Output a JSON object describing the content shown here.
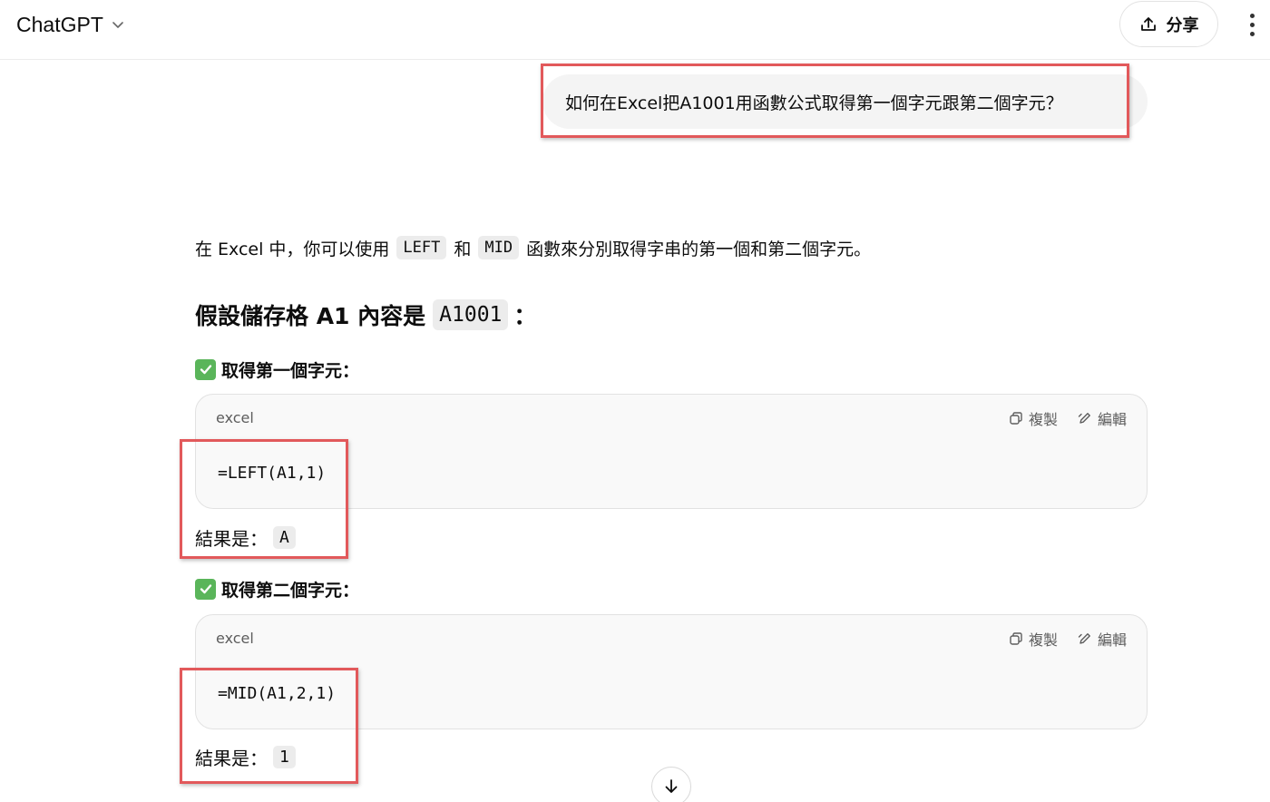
{
  "header": {
    "model_name": "ChatGPT",
    "share_label": "分享"
  },
  "conversation": {
    "user_message": "如何在Excel把A1001用函數公式取得第一個字元跟第二個字元？",
    "assistant": {
      "intro": {
        "part1": "在 Excel 中，你可以使用",
        "code1": "LEFT",
        "part2": "和",
        "code2": "MID",
        "part3": "函數來分別取得字串的第一個和第二個字元。"
      },
      "heading": {
        "text": "假設儲存格 A1 內容是",
        "code": "A1001",
        "suffix": "："
      },
      "sections": [
        {
          "title": "取得第一個字元：",
          "code_lang": "excel",
          "copy_label": "複製",
          "edit_label": "編輯",
          "code": "=LEFT(A1,1)",
          "result_label": "結果是：",
          "result_value": "A"
        },
        {
          "title": "取得第二個字元：",
          "code_lang": "excel",
          "copy_label": "複製",
          "edit_label": "編輯",
          "code": "=MID(A1,2,1)",
          "result_label": "結果是：",
          "result_value": "1"
        }
      ]
    }
  },
  "icons": {
    "model_chevron": "chevron-down-icon",
    "share": "share-upload-icon",
    "more": "more-vertical-icon",
    "check": "check-mark-icon",
    "copy": "copy-icon",
    "edit": "edit-pencil-icon",
    "scroll": "arrow-down-icon"
  },
  "colors": {
    "annotation": "#e2595b",
    "check_badge": "#5ab55a",
    "bubble": "#f4f4f4",
    "code_bg": "#f9f9f9"
  }
}
